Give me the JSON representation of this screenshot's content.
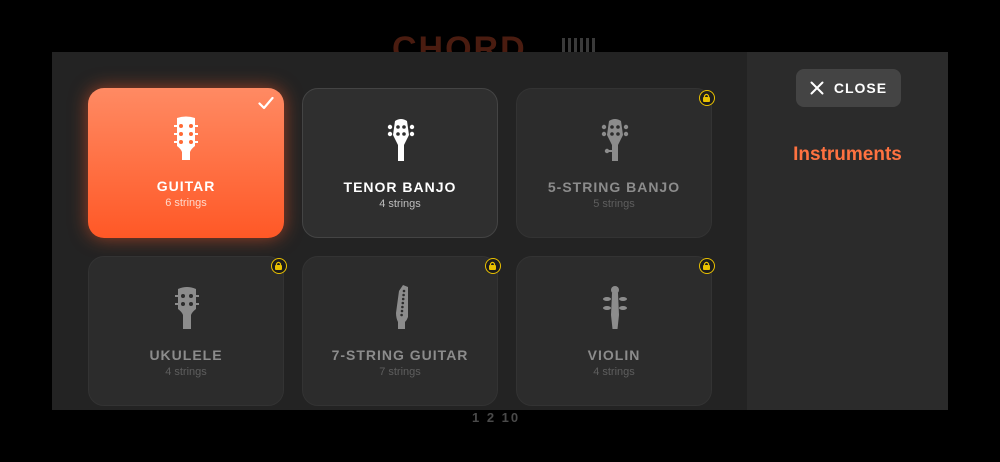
{
  "background": {
    "app_title": "CHORD",
    "footer_text": "1 2 10"
  },
  "close_button": {
    "label": "CLOSE"
  },
  "panel": {
    "title": "Instruments"
  },
  "instruments": [
    {
      "name": "GUITAR",
      "strings": "6 strings",
      "state": "selected"
    },
    {
      "name": "TENOR BANJO",
      "strings": "4 strings",
      "state": "unlocked"
    },
    {
      "name": "5-STRING BANJO",
      "strings": "5 strings",
      "state": "locked"
    },
    {
      "name": "UKULELE",
      "strings": "4 strings",
      "state": "locked"
    },
    {
      "name": "7-STRING GUITAR",
      "strings": "7 strings",
      "state": "locked"
    },
    {
      "name": "VIOLIN",
      "strings": "4 strings",
      "state": "locked"
    }
  ],
  "colors": {
    "accent": "#ff6a35",
    "lock_badge": "#e8c000",
    "modal_bg": "#232323",
    "panel_bg": "#2b2b2b"
  },
  "icons": {
    "guitar": "guitar-headstock-icon",
    "tenor_banjo": "banjo-headstock-icon",
    "five_string_banjo": "five-string-banjo-headstock-icon",
    "ukulele": "ukulele-headstock-icon",
    "seven_string_guitar": "seven-string-guitar-headstock-icon",
    "violin": "violin-scroll-icon",
    "check": "check-icon",
    "lock": "lock-icon",
    "close": "close-icon"
  }
}
